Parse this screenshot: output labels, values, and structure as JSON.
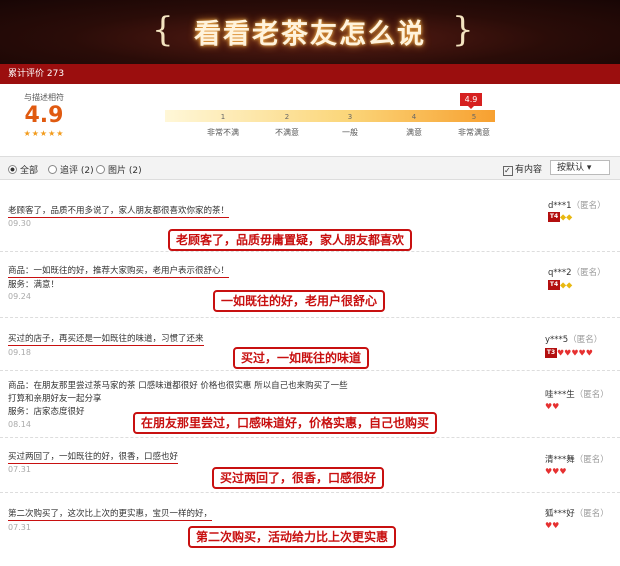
{
  "banner": {
    "title": "看看老茶友怎么说",
    "left_bracket": "{",
    "right_bracket": "}"
  },
  "summary_bar": {
    "label": "累计评价 273"
  },
  "rating": {
    "label": "与描述相符",
    "score": "4.9",
    "stars": "★★★★★",
    "badge": "4.9",
    "scale": [
      {
        "num": "1",
        "label": "非常不满"
      },
      {
        "num": "2",
        "label": "不满意"
      },
      {
        "num": "3",
        "label": "一般"
      },
      {
        "num": "4",
        "label": "满意"
      },
      {
        "num": "5",
        "label": "非常满意"
      }
    ]
  },
  "filters": {
    "all": "全部",
    "append": "追评 (2)",
    "images": "图片 (2)",
    "with_content": "有内容",
    "sort": "按默认 ▾"
  },
  "reviews": [
    {
      "lines": [
        "老顾客了，品质不用多说了，家人朋友都很喜欢你家的茶！"
      ],
      "date": "09.30",
      "callout": "老顾客了，品质毋庸置疑，家人朋友都喜欢",
      "user": "d***1",
      "anon": "（匿名）",
      "level": "T4",
      "gems": "◆◆"
    },
    {
      "lines": [
        "商品：一如既往的好，推荐大家购买，老用户表示很舒心！",
        "服务：满意！"
      ],
      "date": "09.24",
      "callout": "一如既往的好，老用户很舒心",
      "user": "q***2",
      "anon": "（匿名）",
      "level": "T4",
      "gems": "◆◆"
    },
    {
      "lines": [
        "买过的店子，再买还是一如既往的味道，习惯了还来"
      ],
      "date": "09.18",
      "callout": "买过，一如既往的味道",
      "user": "y***5",
      "anon": "（匿名）",
      "level": "T3",
      "gems": "♥♥♥♥♥"
    },
    {
      "lines": [
        "商品：在朋友那里尝过茶马家的茶 口感味道都很好 价格也很实惠 所以自己也来购买了一些",
        "打算和亲朋好友一起分享",
        "服务：店家态度很好"
      ],
      "date": "08.14",
      "callout": "在朋友那里尝过，口感味道好，价格实惠，自己也购买",
      "user": "哇***生",
      "anon": "（匿名）",
      "level": "",
      "gems": "♥♥"
    },
    {
      "lines": [
        "买过两回了，一如既往的好，很香，口感也好"
      ],
      "date": "07.31",
      "callout": "买过两回了，很香，口感很好",
      "user": "清***舞",
      "anon": "（匿名）",
      "level": "",
      "gems": "♥♥♥"
    },
    {
      "lines": [
        "第二次购买了，这次比上次的更实惠，宝贝一样的好，"
      ],
      "date": "07.31",
      "callout": "第二次购买，活动给力比上次更实惠",
      "user": "狐***好",
      "anon": "（匿名）",
      "level": "",
      "gems": "♥♥"
    }
  ]
}
